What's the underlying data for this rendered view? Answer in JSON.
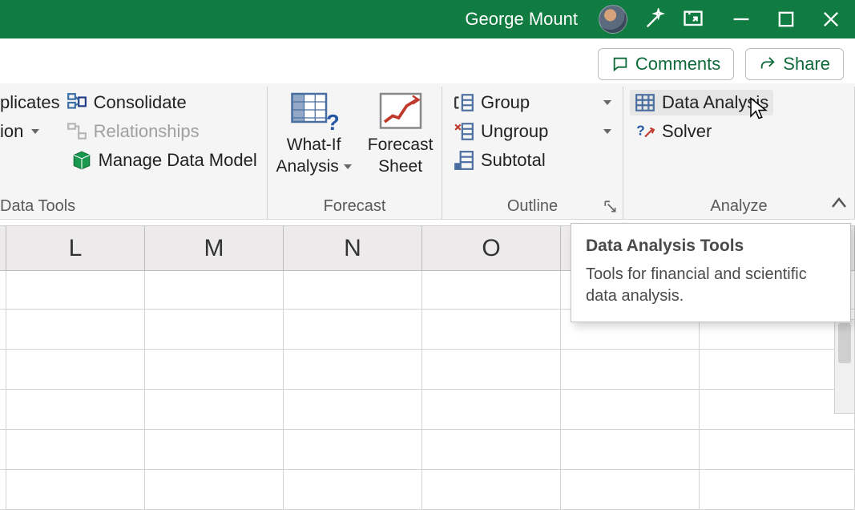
{
  "titlebar": {
    "user_name": "George Mount"
  },
  "sharebar": {
    "comments": "Comments",
    "share": "Share"
  },
  "ribbon": {
    "groups": {
      "datatools": {
        "label": "Data Tools",
        "duplicates": "plicates",
        "validation": "ion",
        "consolidate": "Consolidate",
        "relationships": "Relationships",
        "manage_model": "Manage Data Model"
      },
      "forecast": {
        "label": "Forecast",
        "whatif_l1": "What-If",
        "whatif_l2": "Analysis",
        "sheet_l1": "Forecast",
        "sheet_l2": "Sheet"
      },
      "outline": {
        "label": "Outline",
        "group": "Group",
        "ungroup": "Ungroup",
        "subtotal": "Subtotal"
      },
      "analyze": {
        "label": "Analyze",
        "data_analysis": "Data Analysis",
        "solver": "Solver"
      }
    }
  },
  "columns": [
    "L",
    "M",
    "N",
    "O"
  ],
  "tooltip": {
    "title": "Data Analysis Tools",
    "body": "Tools for financial and scientific data analysis."
  }
}
